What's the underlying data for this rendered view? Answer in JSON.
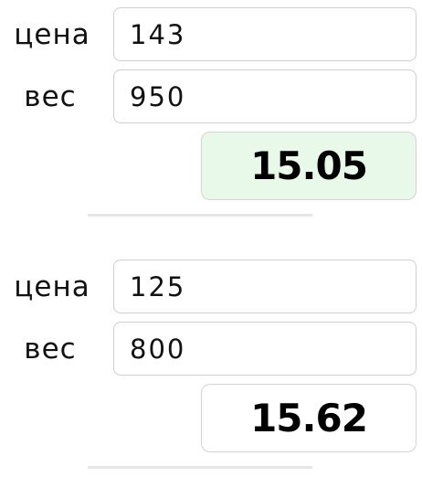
{
  "comparisons": [
    {
      "price_label": "цена",
      "price_value": "143",
      "weight_label": "вес",
      "weight_value": "950",
      "result": "15.05"
    },
    {
      "price_label": "цена",
      "price_value": "125",
      "weight_label": "вес",
      "weight_value": "800",
      "result": "15.62"
    }
  ],
  "colors": {
    "best_result_background": "#e9f9e9",
    "border": "#cfcfcf",
    "divider": "#e6e6e6"
  }
}
